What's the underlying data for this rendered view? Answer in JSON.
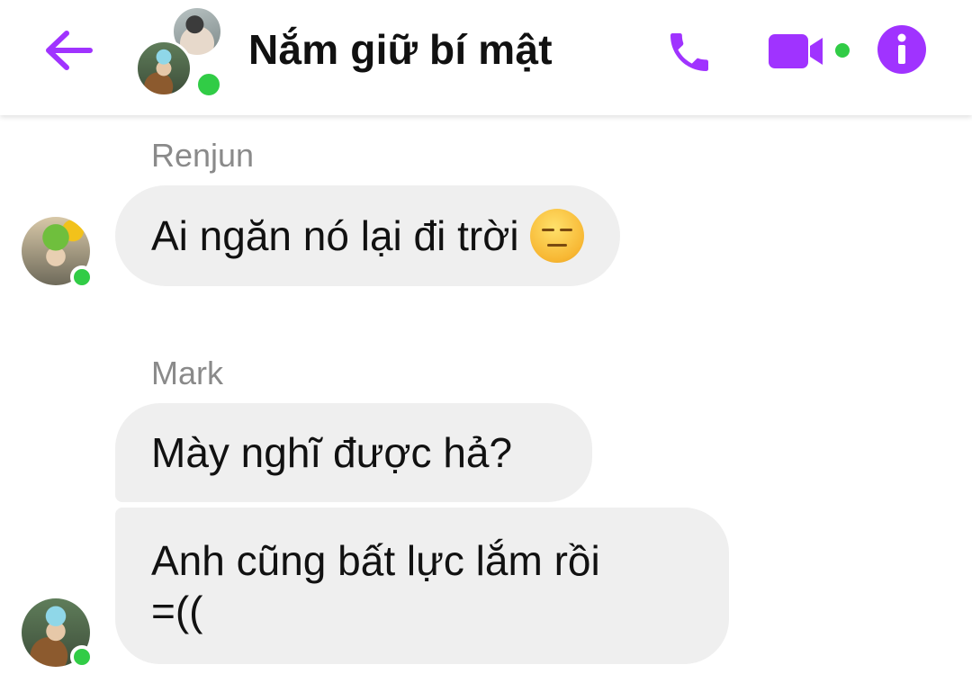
{
  "header": {
    "title": "Nắm giữ bí mật",
    "back_icon": "back-arrow-icon",
    "call_icon": "phone-icon",
    "video_icon": "video-camera-icon",
    "info_icon": "info-icon",
    "accent_color": "#a033ff",
    "online_color": "#31cc46"
  },
  "messages": [
    {
      "sender": "Renjun",
      "bubbles": [
        {
          "text": "Ai ngăn nó lại đi trời",
          "emoji": "expressionless-face-icon"
        }
      ]
    },
    {
      "sender": "Mark",
      "bubbles": [
        {
          "text": "Mày nghĩ được hả?"
        },
        {
          "line1": "Anh cũng bất lực lắm rồi",
          "line2": "=(("
        }
      ]
    }
  ]
}
